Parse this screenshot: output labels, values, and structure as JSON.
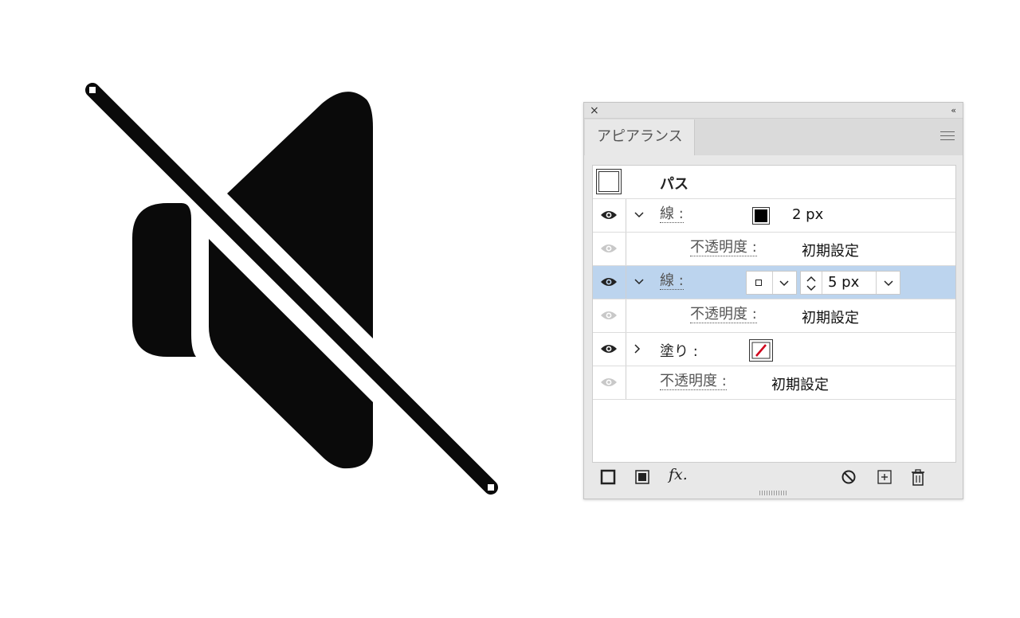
{
  "panel": {
    "close_label": "×",
    "collapse_label": "‹‹",
    "tab_label": "アピアランス",
    "menu_icon": "hamburger-menu-icon"
  },
  "rows": {
    "path": {
      "label": "パス"
    },
    "stroke1": {
      "label": "線 :",
      "weight": "2 px",
      "swatch_color": "#000000"
    },
    "opacity1": {
      "label": "不透明度 :",
      "value": "初期設定"
    },
    "stroke2": {
      "label": "線 :",
      "weight": "5 px"
    },
    "opacity2": {
      "label": "不透明度 :",
      "value": "初期設定"
    },
    "fill": {
      "label": "塗り :",
      "swatch": "none-swatch"
    },
    "opacity3": {
      "label": "不透明度 :",
      "value": "初期設定"
    }
  },
  "footer": {
    "icons": [
      "add-new-stroke-icon",
      "add-new-fill-icon",
      "add-new-effect-icon",
      "clear-appearance-icon",
      "duplicate-item-icon",
      "delete-item-icon"
    ],
    "fx_label": "fx."
  },
  "colors": {
    "selection": "#bcd4ee",
    "artwork": "#0a0a0a",
    "none_slash": "#d0021b"
  }
}
